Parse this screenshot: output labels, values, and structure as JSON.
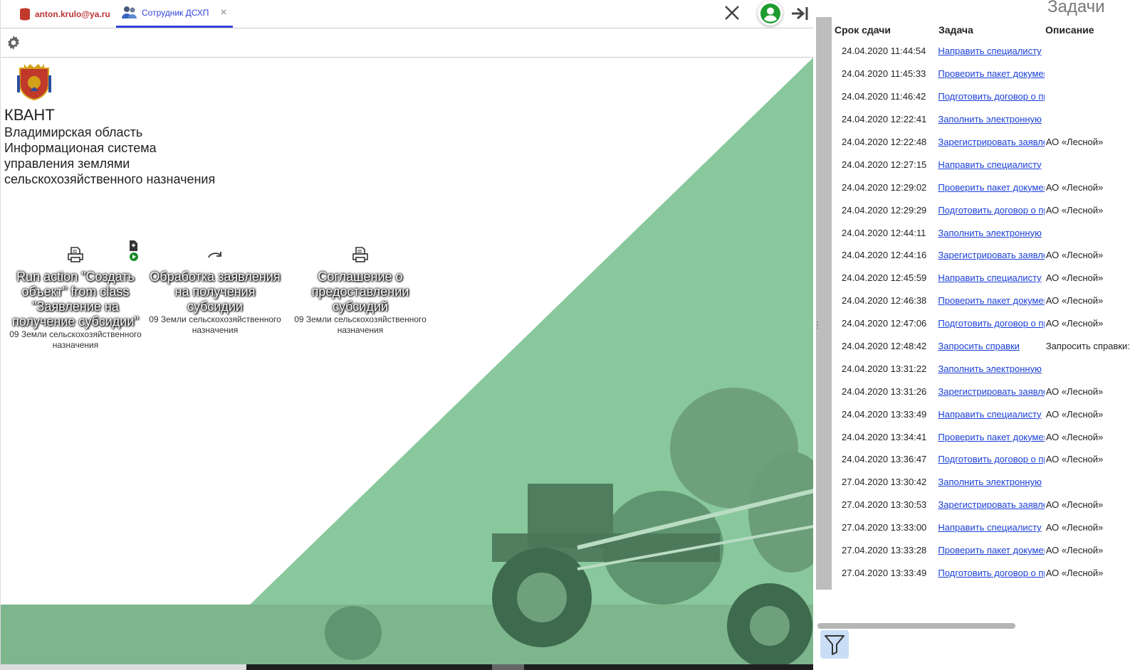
{
  "tabs": {
    "user_label": "anton.krulo@ya.ru",
    "staff_label": "Сотрудник ДСХП",
    "close_glyph": "×"
  },
  "brand": {
    "name": "КВАНТ",
    "region": "Владимирская область",
    "line1": "Информационая система",
    "line2": "управления землями",
    "line3": "сельскохозяйственного назначения"
  },
  "tiles": [
    {
      "title": "Run action \"Создать объект\" from class \"Заявление на получение субсидии\"",
      "subtitle": "09 Земли сельскохозяйственного назначения"
    },
    {
      "title": "Обработка заявления на получения субсидии",
      "subtitle": "09 Земли сельскохозяйственного назначения"
    },
    {
      "title": "Соглашение о предоставлении субсидий",
      "subtitle": "09 Земли сельскохозяйственного назначения"
    }
  ],
  "tasks": {
    "title": "Задачи",
    "columns": {
      "date": "Срок сдачи",
      "task": "Задача",
      "desc": "Описание"
    },
    "rows": [
      {
        "date": "24.04.2020 11:44:54",
        "task": "Направить специалисту",
        "desc": ""
      },
      {
        "date": "24.04.2020 11:45:33",
        "task": "Проверить пакет документов",
        "desc": ""
      },
      {
        "date": "24.04.2020 11:46:42",
        "task": "Подготовить договор о предоставлении",
        "desc": ""
      },
      {
        "date": "24.04.2020 12:22:41",
        "task": "Заполнить электронную",
        "desc": ""
      },
      {
        "date": "24.04.2020 12:22:48",
        "task": "Зарегистрировать заявление",
        "desc": "АО «Лесной»"
      },
      {
        "date": "24.04.2020 12:27:15",
        "task": "Направить специалисту",
        "desc": ""
      },
      {
        "date": "24.04.2020 12:29:02",
        "task": "Проверить пакет документов",
        "desc": "АО «Лесной»"
      },
      {
        "date": "24.04.2020 12:29:29",
        "task": "Подготовить договор о предоставлении",
        "desc": "АО «Лесной»"
      },
      {
        "date": "24.04.2020 12:44:11",
        "task": "Заполнить электронную",
        "desc": ""
      },
      {
        "date": "24.04.2020 12:44:16",
        "task": "Зарегистрировать заявление",
        "desc": "АО «Лесной»"
      },
      {
        "date": "24.04.2020 12:45:59",
        "task": "Направить специалисту",
        "desc": "АО «Лесной»"
      },
      {
        "date": "24.04.2020 12:46:38",
        "task": "Проверить пакет документов",
        "desc": "АО «Лесной»"
      },
      {
        "date": "24.04.2020 12:47:06",
        "task": "Подготовить договор о предоставлении",
        "desc": "АО «Лесной»"
      },
      {
        "date": "24.04.2020 12:48:42",
        "task": "Запросить справки",
        "desc": "Запросить справки:"
      },
      {
        "date": "24.04.2020 13:31:22",
        "task": "Заполнить электронную",
        "desc": ""
      },
      {
        "date": "24.04.2020 13:31:26",
        "task": "Зарегистрировать заявление",
        "desc": "АО «Лесной»"
      },
      {
        "date": "24.04.2020 13:33:49",
        "task": "Направить специалисту",
        "desc": "АО «Лесной»"
      },
      {
        "date": "24.04.2020 13:34:41",
        "task": "Проверить пакет документов",
        "desc": "АО «Лесной»"
      },
      {
        "date": "24.04.2020 13:36:47",
        "task": "Подготовить договор о предоставлении",
        "desc": "АО «Лесной»"
      },
      {
        "date": "27.04.2020 13:30:42",
        "task": "Заполнить электронную",
        "desc": ""
      },
      {
        "date": "27.04.2020 13:30:53",
        "task": "Зарегистрировать заявление",
        "desc": "АО «Лесной»"
      },
      {
        "date": "27.04.2020 13:33:00",
        "task": "Направить специалисту",
        "desc": "АО «Лесной»"
      },
      {
        "date": "27.04.2020 13:33:28",
        "task": "Проверить пакет документов",
        "desc": "АО «Лесной»"
      },
      {
        "date": "27.04.2020 13:33:49",
        "task": "Подготовить договор о предоставлении",
        "desc": "АО «Лесной»"
      }
    ]
  },
  "icons": {
    "database": "database-icon",
    "users": "users-icon",
    "close": "close-icon",
    "account": "account-circle-icon",
    "collapse": "collapse-right-icon",
    "settings": "gear-icon",
    "print": "printer-icon",
    "redo": "redo-icon",
    "filter": "filter-icon"
  },
  "colors": {
    "accent": "#3344dd",
    "user_tab": "#b33333",
    "link": "#1a3fd8",
    "banner_green": "#88c89c",
    "account_green": "#1e9b2e"
  }
}
